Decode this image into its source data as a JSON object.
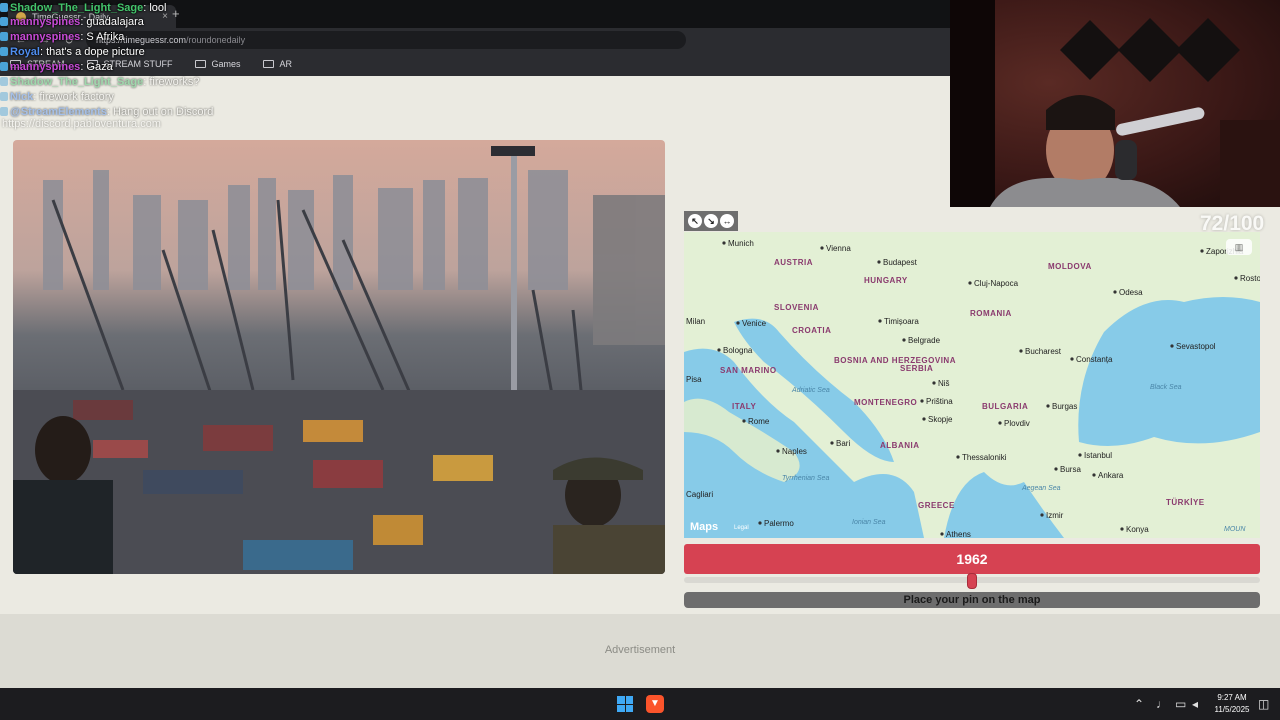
{
  "browser": {
    "tab_title": "TimeGuessr - Daily",
    "tab_close": "×",
    "new_tab": "+",
    "url_domain": "timeguessr.com",
    "url_path": "/roundonedaily",
    "url_prefix": "https://",
    "bookmarks": [
      {
        "label": "STREAM"
      },
      {
        "label": "STREAM STUFF"
      },
      {
        "label": "Games"
      },
      {
        "label": "AR"
      }
    ]
  },
  "chat": {
    "lines": [
      {
        "user": "Shadow_The_Light_Sage",
        "text": ": lool",
        "color": "#43c46b",
        "faded": false
      },
      {
        "user": "mannyspines",
        "text": ": guadalajara",
        "color": "#c74bd6",
        "faded": false
      },
      {
        "user": "mannyspines",
        "text": ": S Afrika",
        "color": "#c74bd6",
        "faded": false
      },
      {
        "user": "Royal",
        "text": ": that's a dope picture",
        "color": "#4f8df0",
        "faded": false
      },
      {
        "user": "mannyspines",
        "text": ": Gaza",
        "color": "#c74bd6",
        "faded": false
      },
      {
        "user": "Shadow_The_Light_Sage",
        "text": ": fireworks?",
        "color": "#43c46b",
        "faded": true
      },
      {
        "user": "Nick",
        "text": ": firework factory",
        "color": "#4f8df0",
        "faded": true
      },
      {
        "user": "@StreamElements",
        "text": ": Hang out on Discord",
        "color": "#4f8df0",
        "faded": true
      }
    ],
    "link": "https://discord.pabloventura.com"
  },
  "game": {
    "score": "72/100",
    "year": "1962",
    "year_fraction": 0.5,
    "pin_prompt": "Place your pin on the map",
    "advertisement": "Advertisement",
    "map_credit": "Maps",
    "map_legal": "Legal",
    "map_labels": [
      {
        "text": "Munich",
        "kind": "city"
      },
      {
        "text": "Vienna",
        "kind": "city"
      },
      {
        "text": "Budapest",
        "kind": "city"
      },
      {
        "text": "AUSTRIA",
        "kind": "country"
      },
      {
        "text": "HUNGARY",
        "kind": "country"
      },
      {
        "text": "MOLDOVA",
        "kind": "country"
      },
      {
        "text": "Zaporizhia",
        "kind": "city"
      },
      {
        "text": "Cluj-Napoca",
        "kind": "city"
      },
      {
        "text": "Odesa",
        "kind": "city"
      },
      {
        "text": "Rosto",
        "kind": "city"
      },
      {
        "text": "SLOVENIA",
        "kind": "country"
      },
      {
        "text": "ROMANIA",
        "kind": "country"
      },
      {
        "text": "Timișoara",
        "kind": "city"
      },
      {
        "text": "Venice",
        "kind": "city"
      },
      {
        "text": "CROATIA",
        "kind": "country"
      },
      {
        "text": "Milan",
        "kind": "city"
      },
      {
        "text": "Belgrade",
        "kind": "city"
      },
      {
        "text": "Bologna",
        "kind": "city"
      },
      {
        "text": "Bucharest",
        "kind": "city"
      },
      {
        "text": "Sevastopol",
        "kind": "city"
      },
      {
        "text": "BOSNIA AND HERZEGOVINA",
        "kind": "country"
      },
      {
        "text": "Constanța",
        "kind": "city"
      },
      {
        "text": "SAN MARINO",
        "kind": "country"
      },
      {
        "text": "SERBIA",
        "kind": "country"
      },
      {
        "text": "Pisa",
        "kind": "city"
      },
      {
        "text": "Black Sea",
        "kind": "sea"
      },
      {
        "text": "Niš",
        "kind": "city"
      },
      {
        "text": "MONTENEGRO",
        "kind": "country"
      },
      {
        "text": "Priština",
        "kind": "city"
      },
      {
        "text": "ITALY",
        "kind": "country"
      },
      {
        "text": "BULGARIA",
        "kind": "country"
      },
      {
        "text": "Burgas",
        "kind": "city"
      },
      {
        "text": "Adriatic Sea",
        "kind": "sea"
      },
      {
        "text": "Skopje",
        "kind": "city"
      },
      {
        "text": "Rome",
        "kind": "city"
      },
      {
        "text": "Plovdiv",
        "kind": "city"
      },
      {
        "text": "ALBANIA",
        "kind": "country"
      },
      {
        "text": "Bari",
        "kind": "city"
      },
      {
        "text": "Istanbul",
        "kind": "city"
      },
      {
        "text": "Naples",
        "kind": "city"
      },
      {
        "text": "Thessaloniki",
        "kind": "city"
      },
      {
        "text": "Bursa",
        "kind": "city"
      },
      {
        "text": "Tyrrhenian Sea",
        "kind": "sea"
      },
      {
        "text": "Ankara",
        "kind": "city"
      },
      {
        "text": "Aegean Sea",
        "kind": "sea"
      },
      {
        "text": "Cagliari",
        "kind": "city"
      },
      {
        "text": "GREECE",
        "kind": "country"
      },
      {
        "text": "TÜRKİYE",
        "kind": "country"
      },
      {
        "text": "Izmir",
        "kind": "city"
      },
      {
        "text": "Palermo",
        "kind": "city"
      },
      {
        "text": "Ionian Sea",
        "kind": "sea"
      },
      {
        "text": "Konya",
        "kind": "city"
      },
      {
        "text": "Athens",
        "kind": "city"
      },
      {
        "text": "MOUN",
        "kind": "sea"
      }
    ]
  },
  "taskbar": {
    "time": "9:27 AM",
    "date": "11/5/2025"
  },
  "colors": {
    "accent": "#d64252",
    "land": "#e3f0d5",
    "sea": "#87cbe8",
    "page_bg": "#ebeae2"
  }
}
